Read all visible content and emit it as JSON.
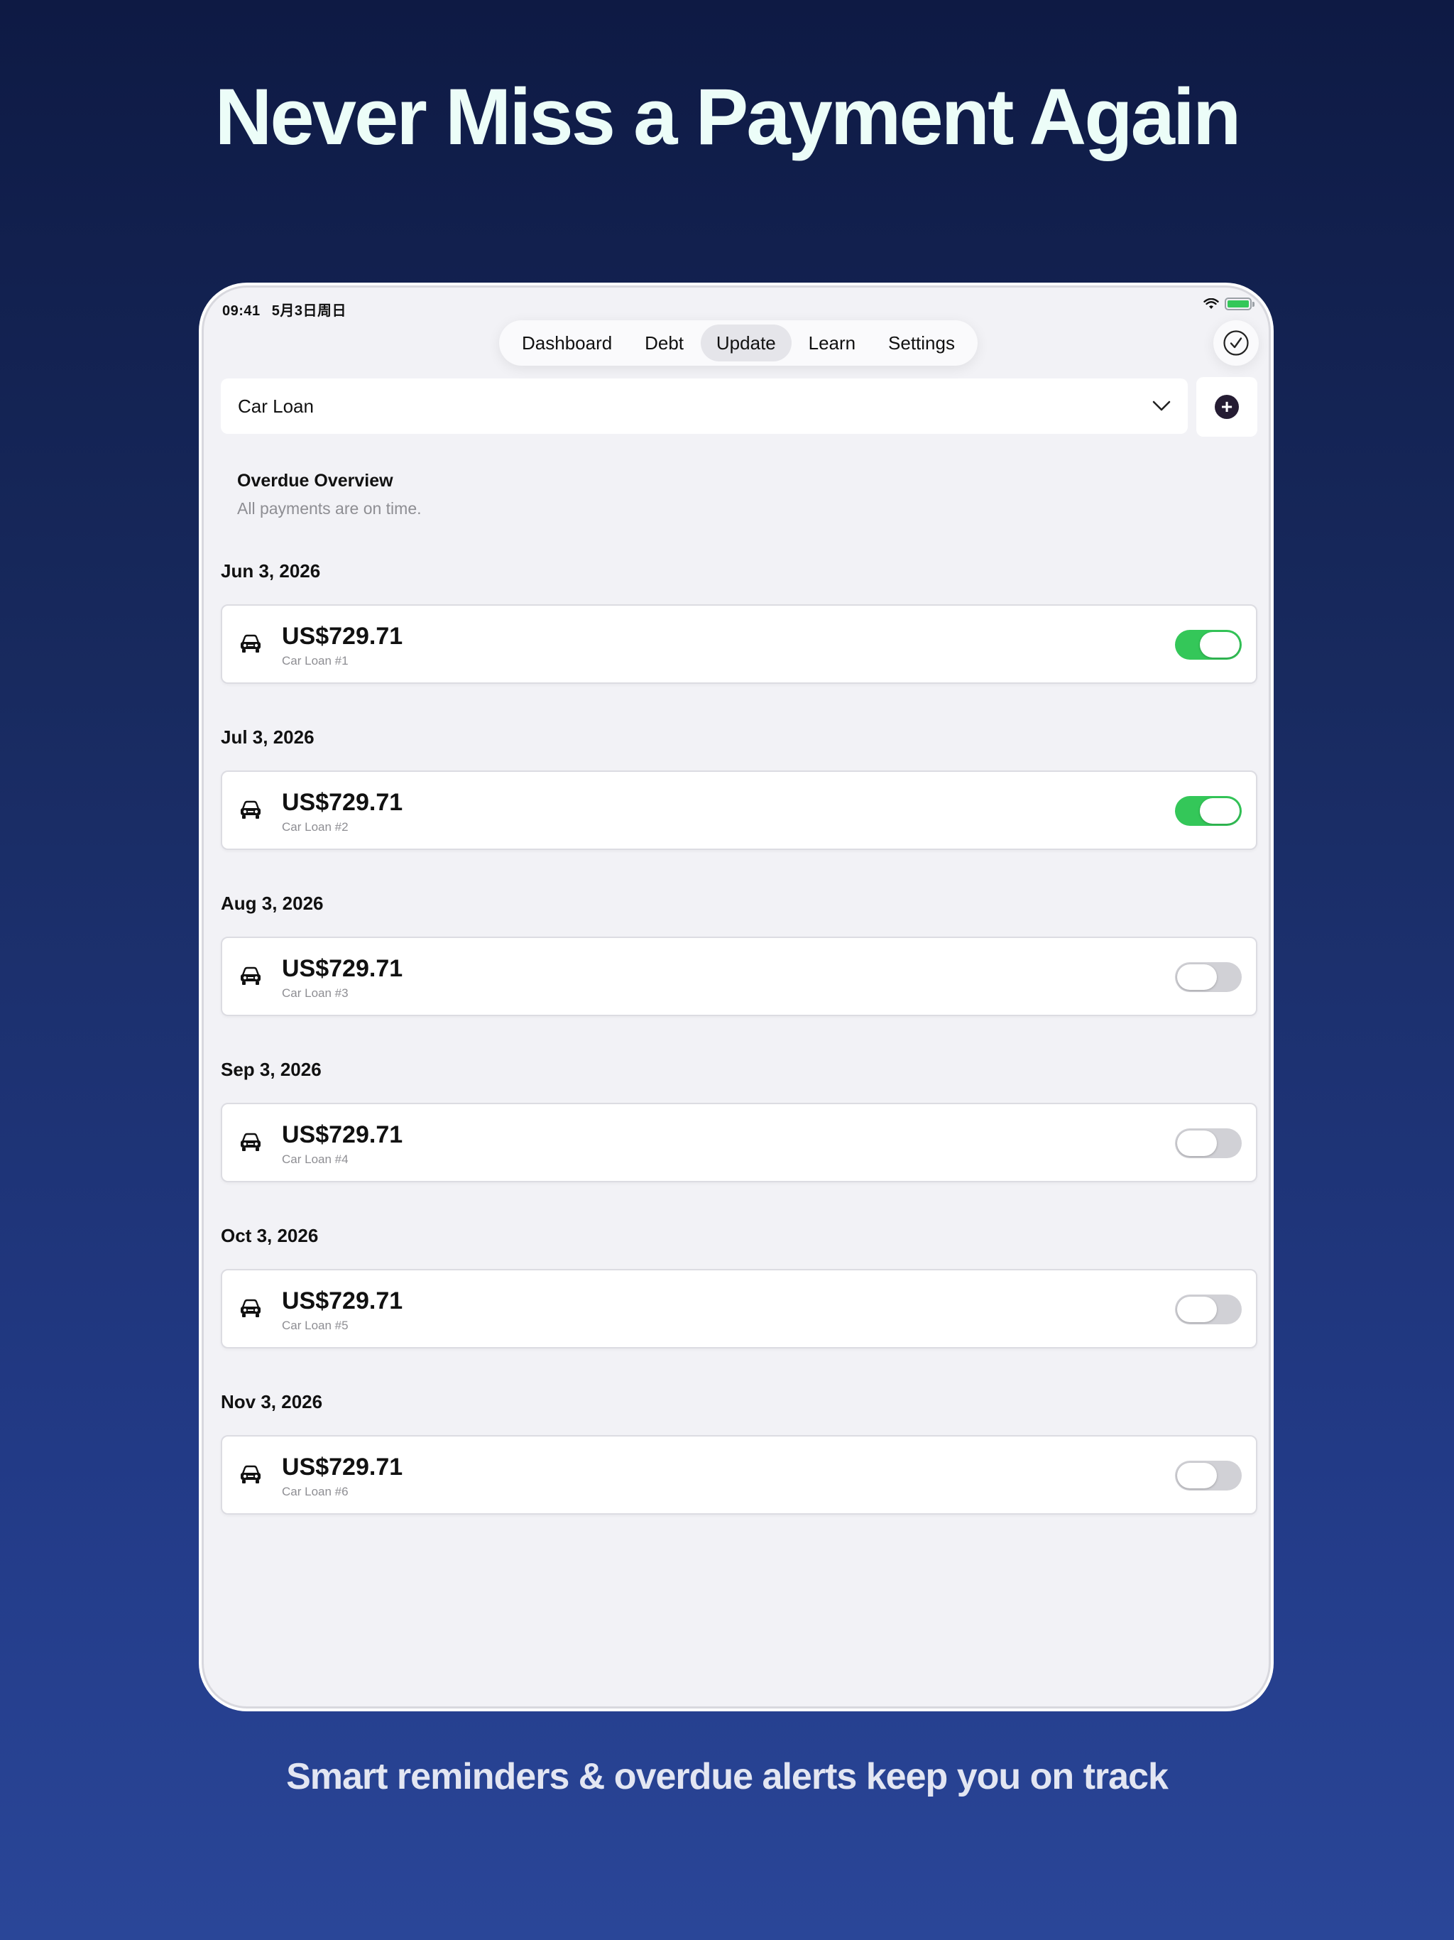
{
  "headline": "Never Miss a Payment Again",
  "subline": "Smart reminders & overdue alerts keep you on track",
  "status_bar": {
    "time": "09:41",
    "date": "5月3日周日"
  },
  "tabs": [
    {
      "label": "Dashboard",
      "active": false
    },
    {
      "label": "Debt",
      "active": false
    },
    {
      "label": "Update",
      "active": true
    },
    {
      "label": "Learn",
      "active": false
    },
    {
      "label": "Settings",
      "active": false
    }
  ],
  "selector": {
    "value": "Car Loan"
  },
  "overview": {
    "title": "Overdue Overview",
    "subtitle": "All payments are on time."
  },
  "payments": [
    {
      "date": "Jun 3, 2026",
      "amount": "US$729.71",
      "name": "Car Loan #1",
      "paid": true
    },
    {
      "date": "Jul 3, 2026",
      "amount": "US$729.71",
      "name": "Car Loan #2",
      "paid": true
    },
    {
      "date": "Aug 3, 2026",
      "amount": "US$729.71",
      "name": "Car Loan #3",
      "paid": false
    },
    {
      "date": "Sep 3, 2026",
      "amount": "US$729.71",
      "name": "Car Loan #4",
      "paid": false
    },
    {
      "date": "Oct 3, 2026",
      "amount": "US$729.71",
      "name": "Car Loan #5",
      "paid": false
    },
    {
      "date": "Nov 3, 2026",
      "amount": "US$729.71",
      "name": "Car Loan #6",
      "paid": false
    }
  ],
  "colors": {
    "toggle_on": "#34c759",
    "toggle_off": "#d1d1d6",
    "accent_dark": "#251c33"
  },
  "icons": {
    "row": "car-icon",
    "add": "plus-circle-icon",
    "done": "checkmark-circle-icon",
    "dropdown": "chevron-down-icon"
  }
}
